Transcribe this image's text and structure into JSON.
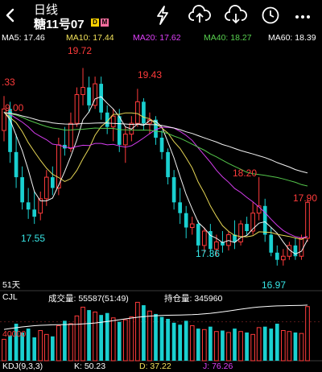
{
  "header": {
    "title": "日线",
    "subtitle": "糖11号07",
    "badges": [
      {
        "text": "D",
        "color": "#ffd400"
      },
      {
        "text": "M",
        "color": "#ff6fa0"
      }
    ],
    "icons": [
      "back-arrow-icon",
      "flash-icon",
      "cloud-upload-icon",
      "cloud-download-icon",
      "clock-icon",
      "more-icon"
    ]
  },
  "ma": [
    {
      "label": "MA5: 17.46",
      "color": "#ffffff"
    },
    {
      "label": "MA10: 17.44",
      "color": "#f2e25a"
    },
    {
      "label": "MA20: 17.62",
      "color": "#e040fb"
    },
    {
      "label": "MA40: 18.27",
      "color": "#58d14f"
    },
    {
      "label": "MA60: 18.39",
      "color": "#ffffff"
    }
  ],
  "price_labels": [
    {
      "text": "19.72",
      "color": "#ff3b3b"
    },
    {
      "text": "19.43",
      "color": "#ff3b3b"
    },
    {
      "text": ".33",
      "color": "#ff3b3b"
    },
    {
      "text": "9.00",
      "color": "#ff3b3b"
    },
    {
      "text": "18.20",
      "color": "#ff3b3b"
    },
    {
      "text": "17.90",
      "color": "#ff3b3b"
    },
    {
      "text": "17.55",
      "color": "#37e6e6"
    },
    {
      "text": "17.36",
      "color": "#37e6e6"
    },
    {
      "text": "16.97",
      "color": "#37e6e6"
    }
  ],
  "period_label": "51天",
  "volume": {
    "indicator": "CJL",
    "volume_label": "成交量: 55587(51:49)",
    "oi_label": "持仓量: 345960",
    "axis_label": "40000"
  },
  "kdj": {
    "label": "KDJ(9,3,3)",
    "k": "K: 50.23",
    "d": "D: 37.22",
    "j": "J: 76.26"
  },
  "colors": {
    "up": "#ff3b3b",
    "down": "#1ad0d0",
    "text_red": "#ff3b3b",
    "text_cyan": "#37e6e6"
  },
  "chart_data": {
    "type": "candlestick",
    "up_color": "#ff3b3b",
    "down_color": "#1ad0d0",
    "candles": [
      {
        "o": 18.85,
        "h": 19.33,
        "l": 18.7,
        "c": 19.15
      },
      {
        "o": 19.15,
        "h": 19.25,
        "l": 18.4,
        "c": 18.55
      },
      {
        "o": 18.55,
        "h": 18.8,
        "l": 18.05,
        "c": 18.2
      },
      {
        "o": 18.2,
        "h": 18.35,
        "l": 17.75,
        "c": 17.85
      },
      {
        "o": 17.85,
        "h": 18.05,
        "l": 17.62,
        "c": 17.75
      },
      {
        "o": 17.75,
        "h": 18.0,
        "l": 17.55,
        "c": 17.65
      },
      {
        "o": 17.7,
        "h": 18.0,
        "l": 17.6,
        "c": 17.9
      },
      {
        "o": 17.9,
        "h": 18.3,
        "l": 17.8,
        "c": 18.2
      },
      {
        "o": 18.2,
        "h": 18.35,
        "l": 17.95,
        "c": 18.05
      },
      {
        "o": 18.05,
        "h": 18.75,
        "l": 17.95,
        "c": 18.65
      },
      {
        "o": 18.65,
        "h": 18.9,
        "l": 18.5,
        "c": 18.6
      },
      {
        "o": 18.6,
        "h": 19.1,
        "l": 18.55,
        "c": 18.95
      },
      {
        "o": 18.95,
        "h": 19.45,
        "l": 18.9,
        "c": 19.35
      },
      {
        "o": 19.35,
        "h": 19.72,
        "l": 19.2,
        "c": 19.45
      },
      {
        "o": 19.45,
        "h": 19.6,
        "l": 19.1,
        "c": 19.2
      },
      {
        "o": 19.2,
        "h": 19.6,
        "l": 19.15,
        "c": 19.5
      },
      {
        "o": 19.5,
        "h": 19.6,
        "l": 19.0,
        "c": 19.1
      },
      {
        "o": 19.1,
        "h": 19.2,
        "l": 18.8,
        "c": 18.9
      },
      {
        "o": 18.9,
        "h": 19.15,
        "l": 18.7,
        "c": 19.05
      },
      {
        "o": 19.05,
        "h": 19.15,
        "l": 18.55,
        "c": 18.65
      },
      {
        "o": 18.65,
        "h": 18.9,
        "l": 18.4,
        "c": 18.8
      },
      {
        "o": 18.8,
        "h": 19.05,
        "l": 18.7,
        "c": 18.95
      },
      {
        "o": 18.95,
        "h": 19.43,
        "l": 18.9,
        "c": 19.25
      },
      {
        "o": 19.25,
        "h": 19.3,
        "l": 18.85,
        "c": 18.95
      },
      {
        "o": 18.95,
        "h": 19.1,
        "l": 18.8,
        "c": 19.0
      },
      {
        "o": 19.0,
        "h": 19.05,
        "l": 18.65,
        "c": 18.75
      },
      {
        "o": 18.75,
        "h": 18.85,
        "l": 18.45,
        "c": 18.55
      },
      {
        "o": 18.55,
        "h": 18.6,
        "l": 18.1,
        "c": 18.2
      },
      {
        "o": 18.2,
        "h": 18.3,
        "l": 17.75,
        "c": 17.85
      },
      {
        "o": 17.85,
        "h": 18.05,
        "l": 17.55,
        "c": 17.7
      },
      {
        "o": 17.7,
        "h": 17.8,
        "l": 17.35,
        "c": 17.5
      },
      {
        "o": 17.5,
        "h": 17.65,
        "l": 17.4,
        "c": 17.55
      },
      {
        "o": 17.55,
        "h": 17.6,
        "l": 17.15,
        "c": 17.25
      },
      {
        "o": 17.25,
        "h": 17.5,
        "l": 17.15,
        "c": 17.45
      },
      {
        "o": 17.45,
        "h": 17.55,
        "l": 17.1,
        "c": 17.2
      },
      {
        "o": 17.2,
        "h": 17.4,
        "l": 17.1,
        "c": 17.3
      },
      {
        "o": 17.3,
        "h": 17.45,
        "l": 17.15,
        "c": 17.25
      },
      {
        "o": 17.25,
        "h": 17.45,
        "l": 17.18,
        "c": 17.4
      },
      {
        "o": 17.4,
        "h": 17.6,
        "l": 17.2,
        "c": 17.3
      },
      {
        "o": 17.3,
        "h": 17.6,
        "l": 17.25,
        "c": 17.55
      },
      {
        "o": 17.55,
        "h": 17.65,
        "l": 17.4,
        "c": 17.45
      },
      {
        "o": 17.45,
        "h": 17.85,
        "l": 17.4,
        "c": 17.7
      },
      {
        "o": 17.7,
        "h": 18.2,
        "l": 17.6,
        "c": 17.8
      },
      {
        "o": 17.8,
        "h": 17.9,
        "l": 17.3,
        "c": 17.4
      },
      {
        "o": 17.4,
        "h": 17.5,
        "l": 17.1,
        "c": 17.15
      },
      {
        "o": 17.15,
        "h": 17.25,
        "l": 16.97,
        "c": 17.05
      },
      {
        "o": 17.05,
        "h": 17.2,
        "l": 16.97,
        "c": 17.1
      },
      {
        "o": 17.1,
        "h": 17.3,
        "l": 17.05,
        "c": 17.25
      },
      {
        "o": 17.25,
        "h": 17.35,
        "l": 17.05,
        "c": 17.1
      },
      {
        "o": 17.1,
        "h": 17.4,
        "l": 17.05,
        "c": 17.35
      },
      {
        "o": 17.35,
        "h": 17.9,
        "l": 17.3,
        "c": 17.85
      }
    ],
    "volumes": [
      22000,
      26000,
      38000,
      29000,
      33000,
      24000,
      31000,
      27000,
      25000,
      36000,
      41000,
      38000,
      46000,
      55000,
      52000,
      50000,
      47000,
      49000,
      44000,
      40000,
      42000,
      45000,
      60000,
      57000,
      51000,
      48000,
      45000,
      43000,
      39000,
      37000,
      41000,
      36000,
      33000,
      32000,
      35000,
      30000,
      31000,
      29000,
      33000,
      30000,
      29000,
      27000,
      34000,
      35000,
      33000,
      38000,
      31000,
      30000,
      29000,
      28000,
      55587
    ],
    "volume_axis_ref": 40000
  }
}
